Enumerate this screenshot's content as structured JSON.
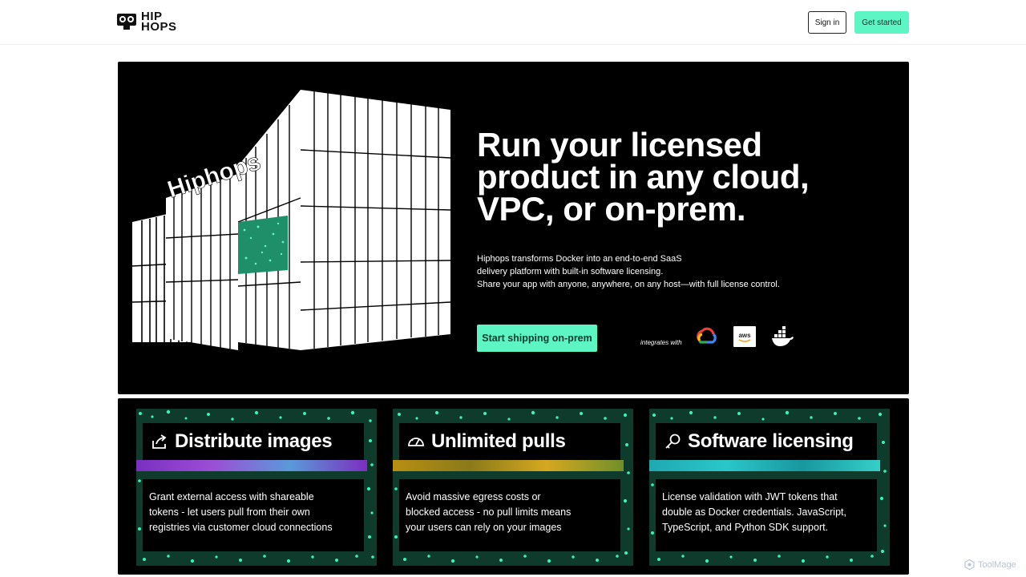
{
  "header": {
    "logo_line1": "HIP",
    "logo_line2": "HOPS",
    "signin_label": "Sign in",
    "getstarted_label": "Get started"
  },
  "hero": {
    "art_label": "Hiphops",
    "title": "Run your licensed product in any cloud, VPC, or on-prem.",
    "description_lines": [
      "Hiphops transforms Docker into an end-to-end SaaS",
      "delivery platform with built-in software licensing.",
      "Share your app with anyone, anywhere, on any host—with full license control."
    ],
    "cta_label": "Start shipping on-prem",
    "integrates_label": "integrates with",
    "integrations": [
      {
        "icon": "google-cloud-icon"
      },
      {
        "icon": "aws-icon",
        "label": "aws"
      },
      {
        "icon": "docker-icon"
      }
    ]
  },
  "features": [
    {
      "icon": "share-icon",
      "title": "Distribute images",
      "band_color": "#8a3fd1",
      "description_lines": [
        "Grant external access with shareable",
        "tokens - let users pull from their own",
        "registries via customer cloud connections"
      ]
    },
    {
      "icon": "gauge-icon",
      "title": "Unlimited pulls",
      "band_color": "#c9a21a",
      "description_lines": [
        "Avoid massive egress costs or",
        "blocked access - no pull limits means",
        "your users can rely on your images"
      ]
    },
    {
      "icon": "key-icon",
      "title": "Software licensing",
      "band_color": "#2ac7c9",
      "description_lines": [
        "License validation with JWT tokens that",
        "double as Docker credentials. JavaScript,",
        "TypeScript, and Python SDK support."
      ]
    }
  ],
  "watermark": "ToolMage",
  "colors": {
    "accent": "#5ef5c5",
    "hero_bg": "#000000",
    "speckle": "#3ef2b0"
  }
}
